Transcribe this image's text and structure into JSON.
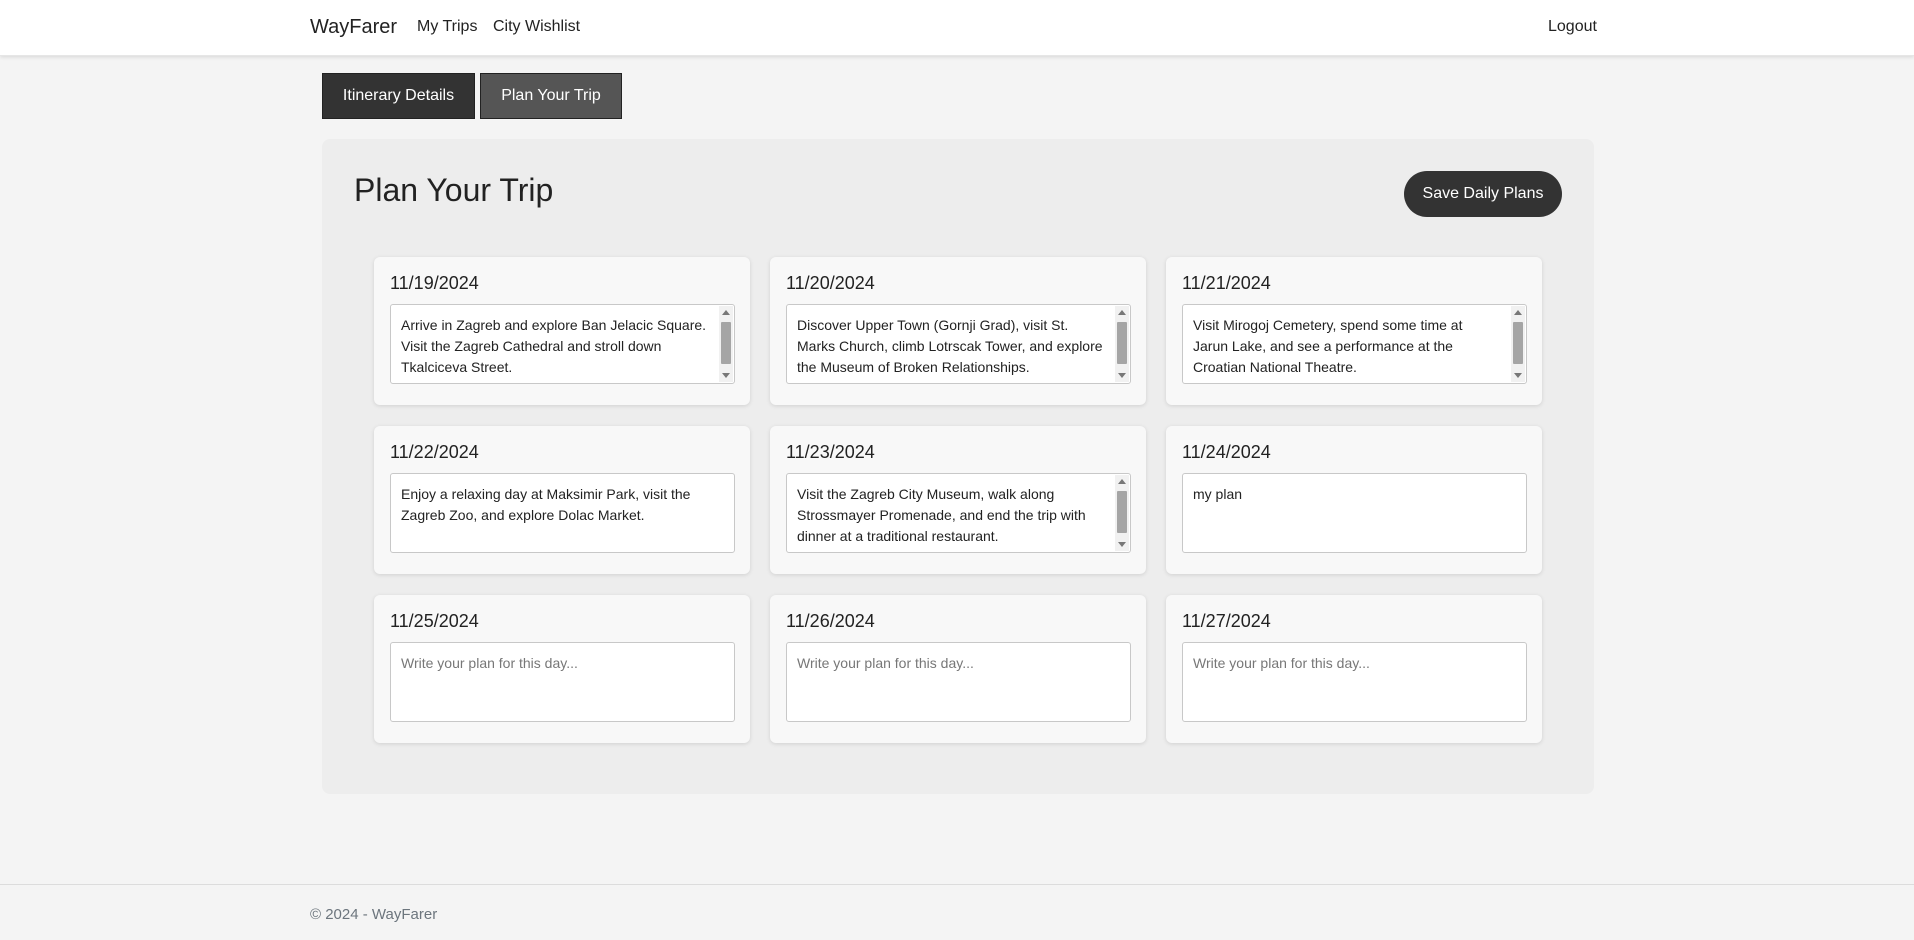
{
  "navbar": {
    "brand": "WayFarer",
    "links": [
      "My Trips",
      "City Wishlist"
    ],
    "logout": "Logout"
  },
  "tabs": [
    {
      "label": "Itinerary Details",
      "active": false
    },
    {
      "label": "Plan Your Trip",
      "active": true
    }
  ],
  "panel": {
    "title": "Plan Your Trip",
    "save_button": "Save Daily Plans",
    "placeholder": "Write your plan for this day...",
    "days": [
      {
        "date": "11/19/2024",
        "plan": "Arrive in Zagreb and explore Ban Jelacic Square. Visit the Zagreb Cathedral and stroll down Tkalciceva Street.",
        "scrollbar": true
      },
      {
        "date": "11/20/2024",
        "plan": "Discover Upper Town (Gornji Grad), visit St. Marks Church, climb Lotrscak Tower, and explore the Museum of Broken Relationships.",
        "scrollbar": true
      },
      {
        "date": "11/21/2024",
        "plan": "Visit Mirogoj Cemetery, spend some time at Jarun Lake, and see a performance at the Croatian National Theatre.",
        "scrollbar": true
      },
      {
        "date": "11/22/2024",
        "plan": "Enjoy a relaxing day at Maksimir Park, visit the Zagreb Zoo, and explore Dolac Market.",
        "scrollbar": false
      },
      {
        "date": "11/23/2024",
        "plan": "Visit the Zagreb City Museum, walk along Strossmayer Promenade, and end the trip with dinner at a traditional restaurant.",
        "scrollbar": true
      },
      {
        "date": "11/24/2024",
        "plan": "my plan",
        "scrollbar": false
      },
      {
        "date": "11/25/2024",
        "plan": "",
        "scrollbar": false
      },
      {
        "date": "11/26/2024",
        "plan": "",
        "scrollbar": false
      },
      {
        "date": "11/27/2024",
        "plan": "",
        "scrollbar": false
      }
    ]
  },
  "footer": {
    "text": "© 2024 - WayFarer"
  },
  "colors": {
    "tab_active": "#555555",
    "tab_inactive": "#333333",
    "button": "#333333",
    "panel_bg": "#ededed"
  }
}
